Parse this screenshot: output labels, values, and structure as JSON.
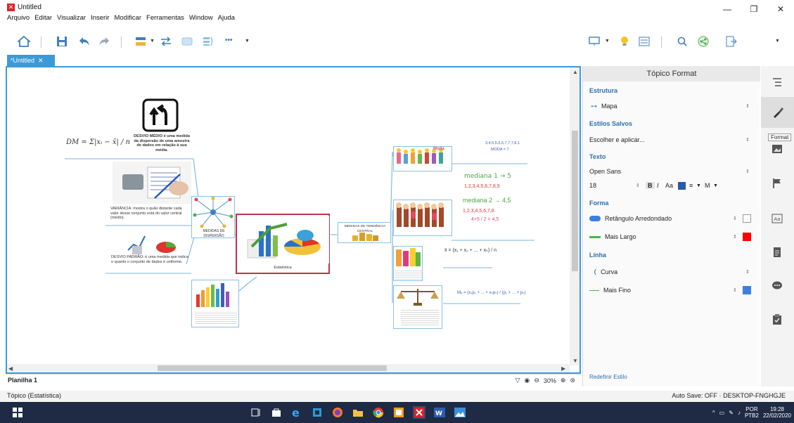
{
  "window": {
    "title": "Untitled",
    "controls": [
      "—",
      "❐",
      "✕"
    ]
  },
  "menu": [
    "Arquivo",
    "Editar",
    "Visualizar",
    "Inserir",
    "Modificar",
    "Ferramentas",
    "Window",
    "Ajuda"
  ],
  "toolbar": {
    "more": "•••"
  },
  "tabs": [
    {
      "label": "*Untitled",
      "close": "✕"
    }
  ],
  "map": {
    "formula_dm": "DM = Σ|xᵢ − x̄| / n",
    "desvio_medio": "DESVIO MÉDIO é uma medida da dispersão de uma amostra de dados em relação à sua média.",
    "variancia": "VARIÂNCIA: mostra o quão distante cada valor desse conjunto está do valor central (médio).",
    "desvio_padrao": "DESVIO PADRÃO: é uma medida que indica o quanto o conjunto de dados é uniforme.",
    "medidas_dispersao": "MEDIDAS DE DISPERSÃO",
    "central": "Estatística",
    "tendencia_central": "MEDIDAS DE TENDÊNCIA CENTRAL",
    "moda": "Moda",
    "moda_seq": "3,4,5,5,6,6,7,7,7,8,1",
    "moda_result": "MODA = 7",
    "mediana1": "mediana 1 → 5",
    "mediana1_seq": "1,2,3,4,5,6,7,8,9",
    "mediana2": "mediana 2 → 4,5",
    "mediana2_seq": "1,2,3,4,5,6,7,8",
    "mediana2_calc": "4+5 / 2 = 4,5",
    "media_formula": "x̄ = (x₁ + x₂ + ... + xₙ) / n",
    "ponderada_formula": "Mₚ = (x₁p₁ + ... + xₙpₙ) / (p₁ + ... + pₙ)"
  },
  "sheet": {
    "tab": "Planilha 1",
    "zoom": "30%"
  },
  "status": {
    "left": "Tópico (Estatística)",
    "autosave": "Auto Save: OFF",
    "host": "DESKTOP-FNGHGJE"
  },
  "panel": {
    "title": "Tópico Format",
    "estrutura": "Estrutura",
    "estrutura_val": "Mapa",
    "estilos": "Estilos Salvos",
    "estilos_val": "Escolher e aplicar...",
    "texto": "Texto",
    "font": "Open Sans",
    "size": "18",
    "forma": "Forma",
    "forma_val": "Retângulo Arredondado",
    "borda_val": "Mais Largo",
    "linha": "Linha",
    "linha_val": "Curva",
    "linha_larg": "Mais Fino",
    "reset": "Redefinir Estilo",
    "tooltip": "Format"
  },
  "taskbar": {
    "lang": "POR",
    "layout": "PTB2",
    "time": "19:28",
    "date": "22/02/2020"
  }
}
